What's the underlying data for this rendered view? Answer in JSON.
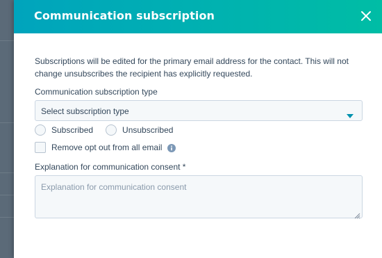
{
  "modal": {
    "title": "Communication subscription",
    "close_icon": "close-icon"
  },
  "intro_text": "Subscriptions will be edited for the primary email address for the contact. This will not change unsubscribes the recipient has explicitly requested.",
  "subscription_type": {
    "label": "Communication subscription type",
    "selected_value": "Select subscription type",
    "caret_icon": "caret-down-icon"
  },
  "status_options": [
    {
      "label": "Subscribed",
      "checked": false
    },
    {
      "label": "Unsubscribed",
      "checked": false
    }
  ],
  "opt_out": {
    "label": "Remove opt out from all email",
    "checked": false,
    "info_icon": "info-icon"
  },
  "explanation": {
    "label": "Explanation for communication consent *",
    "placeholder": "Explanation for communication consent",
    "value": ""
  },
  "colors": {
    "header_start": "#00a4bd",
    "header_end": "#00bda5",
    "text": "#33475b",
    "input_border": "#cbd6e2",
    "input_bg": "#f5f8fa",
    "placeholder": "#8a9aab",
    "caret": "#0091ae"
  }
}
